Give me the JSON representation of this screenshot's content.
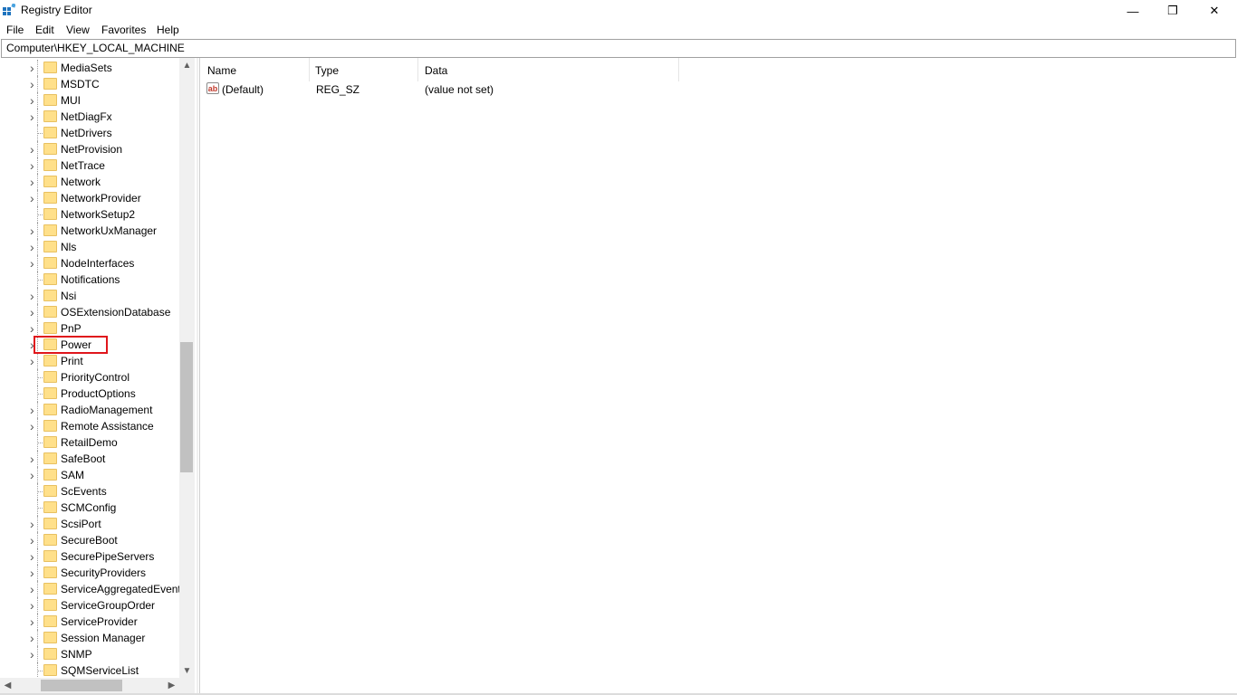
{
  "window": {
    "title": "Registry Editor",
    "controls": {
      "minimize": "—",
      "restore": "❐",
      "close": "✕"
    }
  },
  "menu": [
    "File",
    "Edit",
    "View",
    "Favorites",
    "Help"
  ],
  "address_bar": {
    "path": "Computer\\HKEY_LOCAL_MACHINE"
  },
  "tree": {
    "items": [
      {
        "label": "MediaSets",
        "expandable": true
      },
      {
        "label": "MSDTC",
        "expandable": true
      },
      {
        "label": "MUI",
        "expandable": true
      },
      {
        "label": "NetDiagFx",
        "expandable": true
      },
      {
        "label": "NetDrivers",
        "expandable": false
      },
      {
        "label": "NetProvision",
        "expandable": true
      },
      {
        "label": "NetTrace",
        "expandable": true
      },
      {
        "label": "Network",
        "expandable": true
      },
      {
        "label": "NetworkProvider",
        "expandable": true
      },
      {
        "label": "NetworkSetup2",
        "expandable": false
      },
      {
        "label": "NetworkUxManager",
        "expandable": true
      },
      {
        "label": "Nls",
        "expandable": true
      },
      {
        "label": "NodeInterfaces",
        "expandable": true
      },
      {
        "label": "Notifications",
        "expandable": false
      },
      {
        "label": "Nsi",
        "expandable": true
      },
      {
        "label": "OSExtensionDatabase",
        "expandable": true
      },
      {
        "label": "PnP",
        "expandable": true
      },
      {
        "label": "Power",
        "expandable": true,
        "highlighted": true
      },
      {
        "label": "Print",
        "expandable": true
      },
      {
        "label": "PriorityControl",
        "expandable": false
      },
      {
        "label": "ProductOptions",
        "expandable": false
      },
      {
        "label": "RadioManagement",
        "expandable": true
      },
      {
        "label": "Remote Assistance",
        "expandable": true
      },
      {
        "label": "RetailDemo",
        "expandable": false
      },
      {
        "label": "SafeBoot",
        "expandable": true
      },
      {
        "label": "SAM",
        "expandable": true
      },
      {
        "label": "ScEvents",
        "expandable": false
      },
      {
        "label": "SCMConfig",
        "expandable": false
      },
      {
        "label": "ScsiPort",
        "expandable": true
      },
      {
        "label": "SecureBoot",
        "expandable": true
      },
      {
        "label": "SecurePipeServers",
        "expandable": true
      },
      {
        "label": "SecurityProviders",
        "expandable": true
      },
      {
        "label": "ServiceAggregatedEvents",
        "expandable": true
      },
      {
        "label": "ServiceGroupOrder",
        "expandable": true
      },
      {
        "label": "ServiceProvider",
        "expandable": true
      },
      {
        "label": "Session Manager",
        "expandable": true
      },
      {
        "label": "SNMP",
        "expandable": true
      },
      {
        "label": "SQMServiceList",
        "expandable": false
      }
    ]
  },
  "values_list": {
    "columns": [
      "Name",
      "Type",
      "Data"
    ],
    "rows": [
      {
        "name": "(Default)",
        "type": "REG_SZ",
        "data": "(value not set)",
        "icon": "ab"
      }
    ]
  },
  "colors": {
    "highlight_border": "#e0161c",
    "folder": "#ffe08a"
  }
}
